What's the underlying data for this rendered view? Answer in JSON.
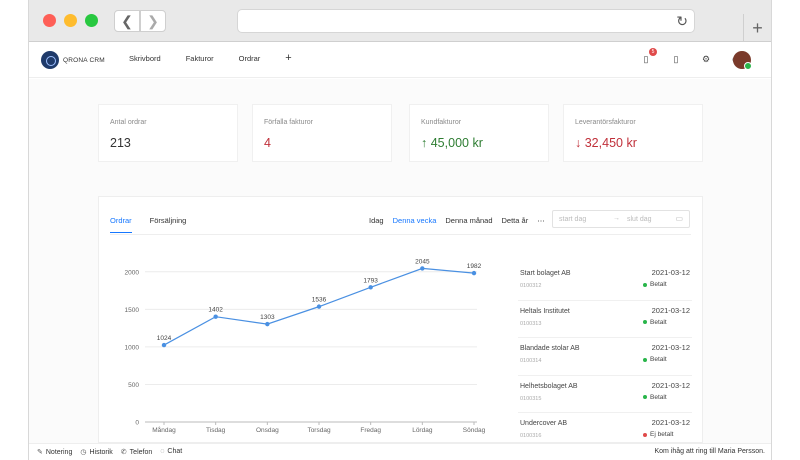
{
  "browser": {
    "back_glyph": "❮",
    "forward_glyph": "❯",
    "reload_glyph": "↻",
    "newtab_glyph": "+"
  },
  "app": {
    "logo_text": "QRONA CRM"
  },
  "nav": {
    "items": [
      "Skrivbord",
      "Fakturor",
      "Ordrar"
    ],
    "add_glyph": "+",
    "notification_count": "5"
  },
  "kpis": [
    {
      "label": "Antal ordrar",
      "value": "213",
      "color": "#333333",
      "arrow": ""
    },
    {
      "label": "Förfalla fakturor",
      "value": "4",
      "color": "#c0303a",
      "arrow": ""
    },
    {
      "label": "Kundfakturor",
      "value": "45,000 kr",
      "color": "#2e7d32",
      "arrow": "↑"
    },
    {
      "label": "Leverantörsfakturor",
      "value": "32,450 kr",
      "color": "#c0303a",
      "arrow": "↓"
    }
  ],
  "panel": {
    "tabs": [
      "Ordrar",
      "Försäljning"
    ],
    "periods": [
      "Idag",
      "Denna vecka",
      "Denna månad",
      "Detta år"
    ],
    "more_glyph": "⋯",
    "range_start_placeholder": "start dag",
    "range_end_placeholder": "slut dag"
  },
  "chart_data": {
    "type": "line",
    "categories": [
      "Måndag",
      "Tisdag",
      "Onsdag",
      "Torsdag",
      "Fredag",
      "Lördag",
      "Söndag"
    ],
    "values": [
      1024,
      1402,
      1303,
      1536,
      1793,
      2045,
      1982
    ],
    "yticks": [
      0,
      500,
      1000,
      1500,
      2000
    ],
    "ylim": [
      0,
      2250
    ],
    "color": "#4a90e2",
    "grid": true
  },
  "orders": [
    {
      "name": "Start bolaget AB",
      "number": "0100312",
      "date": "2021-03-12",
      "status": "Betalt",
      "status_color": "#29b54a"
    },
    {
      "name": "Heltals Institutet",
      "number": "0100313",
      "date": "2021-03-12",
      "status": "Betalt",
      "status_color": "#29b54a"
    },
    {
      "name": "Blandade stolar AB",
      "number": "0100314",
      "date": "2021-03-12",
      "status": "Betalt",
      "status_color": "#29b54a"
    },
    {
      "name": "Helhetsbolaget AB",
      "number": "0100315",
      "date": "2021-03-12",
      "status": "Betalt",
      "status_color": "#29b54a"
    },
    {
      "name": "Undercover AB",
      "number": "0100316",
      "date": "2021-03-12",
      "status": "Ej betalt",
      "status_color": "#e04a4a"
    }
  ],
  "footer": {
    "items": [
      "Notering",
      "Historik",
      "Telefon",
      "Chat"
    ],
    "reminder": "Kom ihåg att ring till Maria Persson."
  }
}
